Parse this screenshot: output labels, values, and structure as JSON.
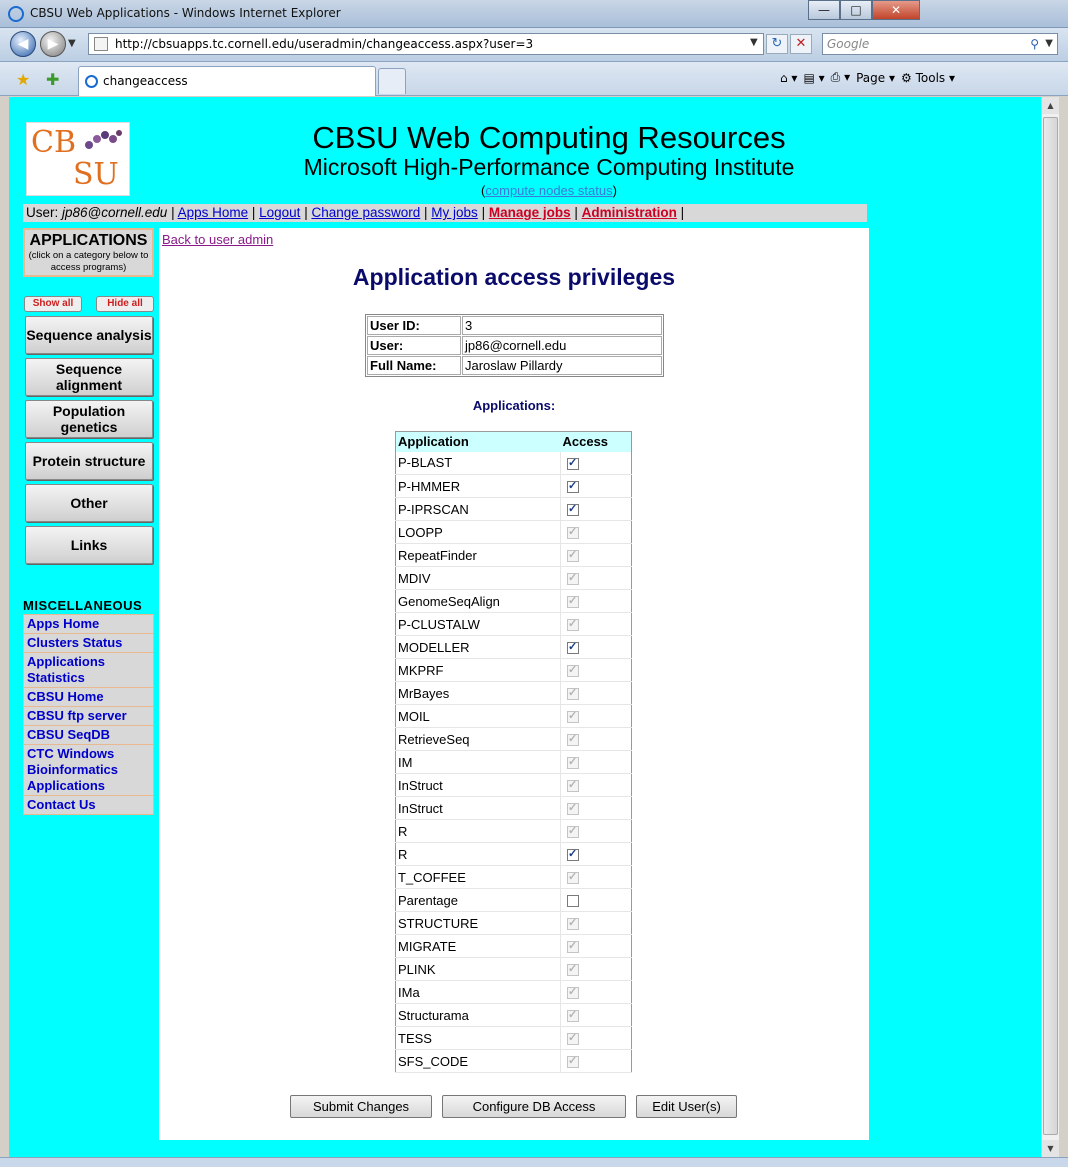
{
  "window": {
    "title": "CBSU Web Applications - Windows Internet Explorer",
    "buttons": {
      "minimize": "—",
      "maximize": "□",
      "close": "✕"
    }
  },
  "browser": {
    "url": "http://cbsuapps.tc.cornell.edu/useradmin/changeaccess.aspx?user=3",
    "search_placeholder": "Google",
    "tab_title": "changeaccess",
    "commands": {
      "page": "Page",
      "tools": "Tools"
    }
  },
  "header": {
    "logo_line1": "CB",
    "logo_line2": "SU",
    "title": "CBSU Web Computing Resources",
    "subtitle": "Microsoft High-Performance Computing Institute",
    "nodes_status_link": "compute nodes status"
  },
  "userbar": {
    "user_label": "User:",
    "user": "jp86@cornell.edu",
    "links": [
      "Apps Home",
      "Logout",
      "Change password",
      "My jobs",
      "Manage jobs",
      "Administration"
    ]
  },
  "sidebar": {
    "apps_title": "APPLICATIONS",
    "apps_hint": "(click on a category below to access programs)",
    "show_all": "Show all",
    "hide_all": "Hide all",
    "categories": [
      "Sequence analysis",
      "Sequence alignment",
      "Population genetics",
      "Protein structure",
      "Other",
      "Links"
    ],
    "misc_title": "MISCELLANEOUS",
    "misc_links": [
      "Apps Home",
      "Clusters Status",
      "Applications Statistics",
      "CBSU Home",
      "CBSU ftp server",
      "CBSU SeqDB",
      "CTC Windows Bioinformatics Applications",
      "Contact Us"
    ]
  },
  "content": {
    "back_link": "Back to user admin",
    "heading": "Application access privileges",
    "user_info": [
      {
        "label": "User ID:",
        "value": "3"
      },
      {
        "label": "User:",
        "value": "jp86@cornell.edu"
      },
      {
        "label": "Full Name:",
        "value": "Jaroslaw Pillardy"
      }
    ],
    "apps_heading": "Applications:",
    "table_headers": {
      "application": "Application",
      "access": "Access"
    },
    "applications": [
      {
        "name": "P-BLAST",
        "checked": true,
        "enabled": true
      },
      {
        "name": "P-HMMER",
        "checked": true,
        "enabled": true
      },
      {
        "name": "P-IPRSCAN",
        "checked": true,
        "enabled": true
      },
      {
        "name": "LOOPP",
        "checked": true,
        "enabled": false
      },
      {
        "name": "RepeatFinder",
        "checked": true,
        "enabled": false
      },
      {
        "name": "MDIV",
        "checked": true,
        "enabled": false
      },
      {
        "name": "GenomeSeqAlign",
        "checked": true,
        "enabled": false
      },
      {
        "name": "P-CLUSTALW",
        "checked": true,
        "enabled": false
      },
      {
        "name": "MODELLER",
        "checked": true,
        "enabled": true
      },
      {
        "name": "MKPRF",
        "checked": true,
        "enabled": false
      },
      {
        "name": "MrBayes",
        "checked": true,
        "enabled": false
      },
      {
        "name": "MOIL",
        "checked": true,
        "enabled": false
      },
      {
        "name": "RetrieveSeq",
        "checked": true,
        "enabled": false
      },
      {
        "name": "IM",
        "checked": true,
        "enabled": false
      },
      {
        "name": "InStruct",
        "checked": true,
        "enabled": false
      },
      {
        "name": "InStruct",
        "checked": true,
        "enabled": false
      },
      {
        "name": "R",
        "checked": true,
        "enabled": false
      },
      {
        "name": "R",
        "checked": true,
        "enabled": true
      },
      {
        "name": "T_COFFEE",
        "checked": true,
        "enabled": false
      },
      {
        "name": "Parentage",
        "checked": false,
        "enabled": true
      },
      {
        "name": "STRUCTURE",
        "checked": true,
        "enabled": false
      },
      {
        "name": "MIGRATE",
        "checked": true,
        "enabled": false
      },
      {
        "name": "PLINK",
        "checked": true,
        "enabled": false
      },
      {
        "name": "IMa",
        "checked": true,
        "enabled": false
      },
      {
        "name": "Structurama",
        "checked": true,
        "enabled": false
      },
      {
        "name": "TESS",
        "checked": true,
        "enabled": false
      },
      {
        "name": "SFS_CODE",
        "checked": true,
        "enabled": false
      }
    ],
    "buttons": {
      "submit": "Submit Changes",
      "db_access": "Configure DB Access",
      "edit_users": "Edit User(s)"
    }
  }
}
